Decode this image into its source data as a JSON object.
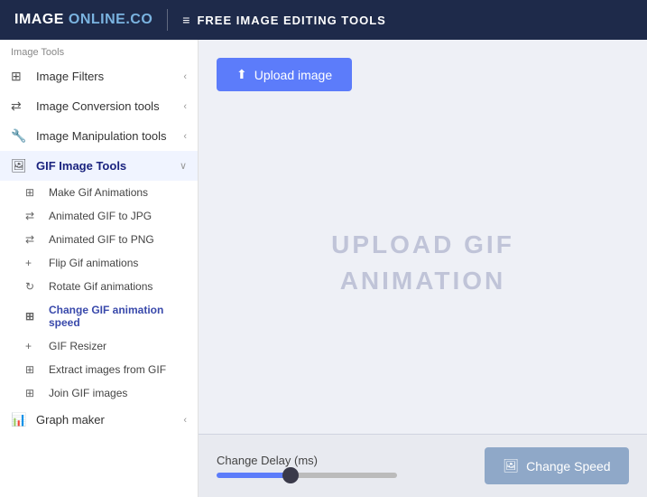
{
  "header": {
    "logo_image": "IMAGE",
    "logo_online": "ONLINE.CO",
    "menu_icon": "≡",
    "title": "FREE IMAGE EDITING TOOLS"
  },
  "sidebar": {
    "section_label": "Image Tools",
    "items": [
      {
        "id": "image-filters",
        "label": "Image Filters",
        "icon": "⊞",
        "arrow": "‹",
        "has_arrow": true
      },
      {
        "id": "image-conversion",
        "label": "Image Conversion tools",
        "icon": "⇄",
        "arrow": "‹",
        "has_arrow": true
      },
      {
        "id": "image-manipulation",
        "label": "Image Manipulation tools",
        "icon": "🔧",
        "arrow": "‹",
        "has_arrow": true
      },
      {
        "id": "gif-image-tools",
        "label": "GIF Image Tools",
        "icon": "🖼",
        "arrow": "∨",
        "has_arrow": true,
        "active": true
      }
    ],
    "sub_items": [
      {
        "id": "make-gif",
        "label": "Make Gif Animations",
        "icon": "⊞"
      },
      {
        "id": "gif-to-jpg",
        "label": "Animated GIF to JPG",
        "icon": "⇄"
      },
      {
        "id": "gif-to-png",
        "label": "Animated GIF to PNG",
        "icon": "⇄"
      },
      {
        "id": "flip-gif",
        "label": "Flip Gif animations",
        "icon": "+"
      },
      {
        "id": "rotate-gif",
        "label": "Rotate Gif animations",
        "icon": "↻"
      },
      {
        "id": "change-speed",
        "label": "Change GIF animation speed",
        "icon": "⊞",
        "active": true
      },
      {
        "id": "gif-resizer",
        "label": "GIF Resizer",
        "icon": "+"
      },
      {
        "id": "extract-images",
        "label": "Extract images from GIF",
        "icon": "⊞"
      },
      {
        "id": "join-gif",
        "label": "Join GIF images",
        "icon": "⊞"
      }
    ],
    "bottom_item": {
      "id": "graph-maker",
      "label": "Graph maker",
      "icon": "📊",
      "arrow": "‹"
    }
  },
  "content": {
    "upload_btn_label": "Upload image",
    "upload_icon": "⬆",
    "gif_placeholder_line1": "UPLOAD GIF",
    "gif_placeholder_line2": "ANIMATION"
  },
  "bottom_bar": {
    "delay_label": "Change Delay (ms)",
    "slider_value": 40,
    "change_speed_label": "Change Speed",
    "speed_icon": "🖼"
  }
}
